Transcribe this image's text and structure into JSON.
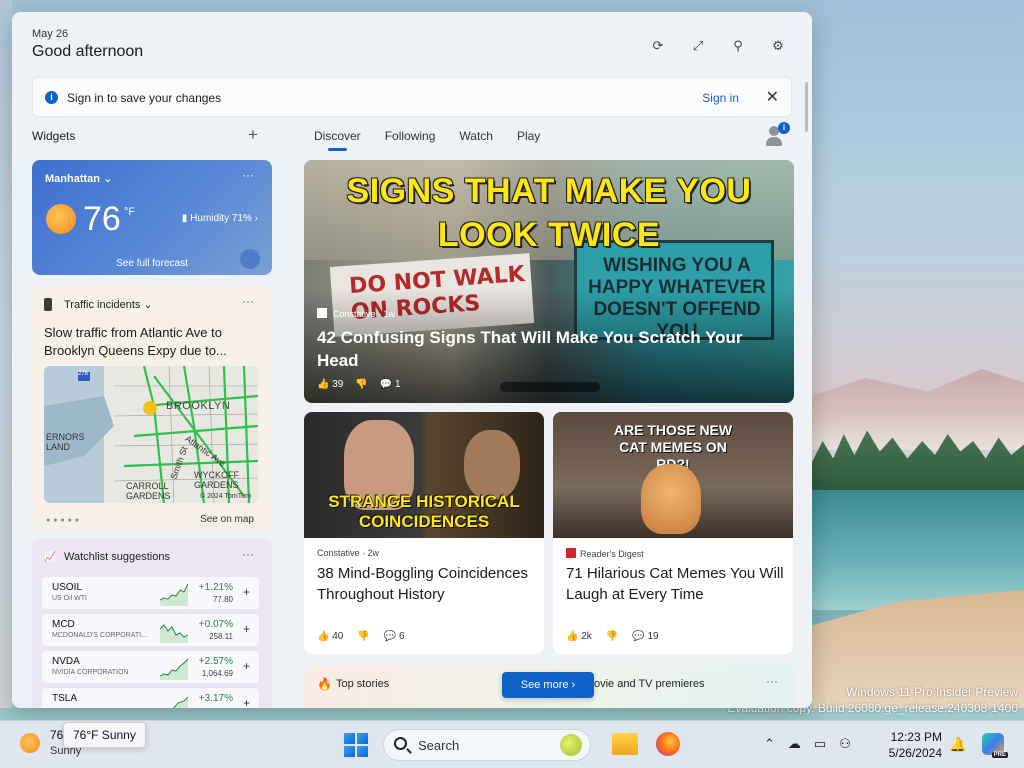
{
  "panel": {
    "date": "May 26",
    "greeting": "Good afternoon"
  },
  "signin_bar": {
    "message": "Sign in to save your changes",
    "link": "Sign in"
  },
  "widgets_header": "Widgets",
  "tabs": [
    {
      "label": "Discover"
    },
    {
      "label": "Following"
    },
    {
      "label": "Watch"
    },
    {
      "label": "Play"
    }
  ],
  "weather": {
    "location": "Manhattan",
    "temp": "76",
    "unit": "°F",
    "humidity": "Humidity 71%",
    "forecast_link": "See full forecast"
  },
  "traffic": {
    "title": "Traffic incidents",
    "description": "Slow traffic from Atlantic Ave to Brooklyn Queens Expy due to...",
    "map_labels": {
      "brooklyn": "BROOKLYN",
      "ernors_land": "ERNORS\nLAND",
      "atlantic": "Atlantic Ave",
      "smith": "Smith St",
      "carroll": "CARROLL\nGARDENS",
      "wyckoff": "WYCKOFF\nGARDENS",
      "copyright": "© 2024 TomTom",
      "route": "278"
    },
    "see_on_map": "See on map"
  },
  "watchlist": {
    "title": "Watchlist suggestions",
    "stocks": [
      {
        "symbol": "USOIL",
        "name": "US Oil WTI",
        "change": "+1.21%",
        "price": "77.80"
      },
      {
        "symbol": "MCD",
        "name": "MCDONALD'S CORPORATI...",
        "change": "+0.07%",
        "price": "258.11"
      },
      {
        "symbol": "NVDA",
        "name": "NVIDIA CORPORATION",
        "change": "+2.57%",
        "price": "1,064.69"
      },
      {
        "symbol": "TSLA",
        "name": "",
        "change": "+3.17%",
        "price": ""
      }
    ]
  },
  "hero": {
    "image_text_line1": "SIGNS THAT MAKE YOU",
    "image_text_line2": "LOOK TWICE",
    "sign_left": "DO NOT WALK\nON ROCKS",
    "sign_right": "WISHING YOU A\nHAPPY WHATEVER\nDOESN'T OFFEND\nYOU",
    "source": "Constative · 1w",
    "title": "42 Confusing Signs That Will Make You Scratch Your Head",
    "likes": "39",
    "comments": "1"
  },
  "cards": [
    {
      "image_text": "STRANGE HISTORICAL COINCIDENCES",
      "source": "Constative · 2w",
      "title": "38 Mind-Boggling Coincidences Throughout History",
      "likes": "40",
      "comments": "6"
    },
    {
      "image_text": "ARE THOSE NEW CAT MEMES ON RD?!",
      "source": "Reader's Digest",
      "title": "71 Hilarious Cat Memes You Will Laugh at Every Time",
      "likes": "2k",
      "comments": "19"
    }
  ],
  "strip": {
    "top_stories": "Top stories",
    "movie": "ovie and TV premieres",
    "see_more": "See more"
  },
  "watermark": {
    "line1": "Windows 11 Pro Insider Preview",
    "line2": "Evaluation copy. Build 26080.ge_release.240308-1400"
  },
  "taskbar": {
    "temp": "76",
    "condition": "Sunny",
    "tooltip": "76°F Sunny",
    "search_placeholder": "Search",
    "time": "12:23 PM",
    "date": "5/26/2024",
    "copilot_badge": "PRE"
  },
  "colors": {
    "accent": "#0f62c8",
    "positive": "#1f8a3b",
    "headline_yellow": "#ffe615"
  }
}
